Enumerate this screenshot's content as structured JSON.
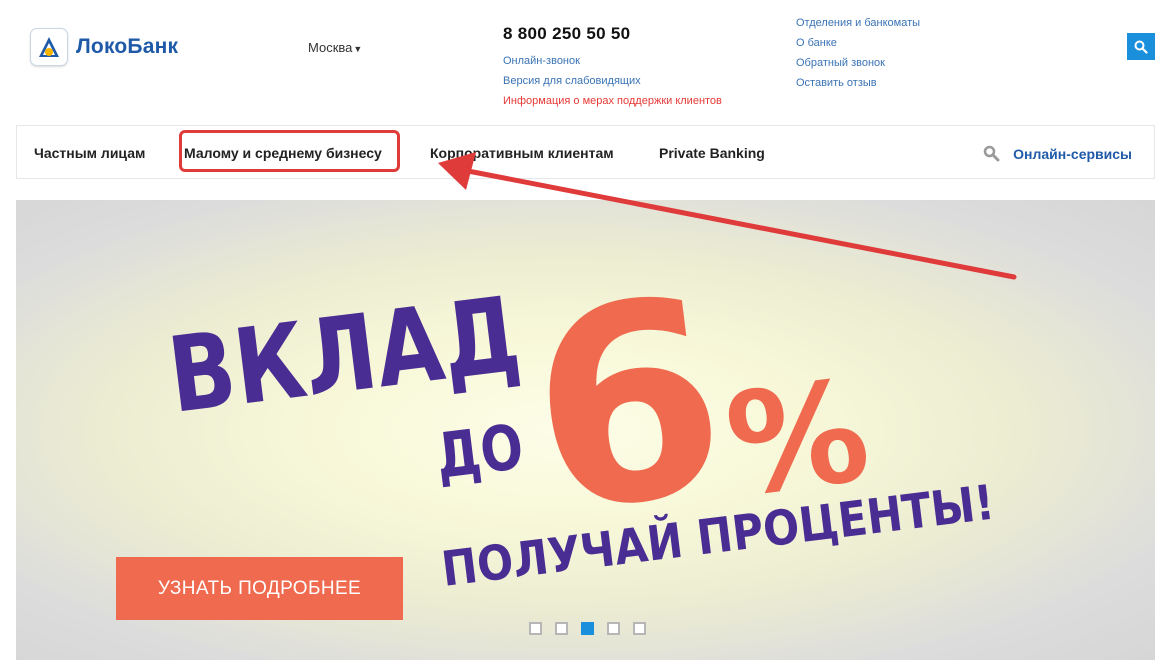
{
  "header": {
    "logo_text": "ЛокоБанк",
    "city": "Москва",
    "phone": "8 800 250 50 50",
    "phone_links": [
      "Онлайн-звонок",
      "Версия для слабовидящих"
    ],
    "support_info": "Информация о мерах поддержки клиентов",
    "right_links": [
      "Отделения и банкоматы",
      "О банке",
      "Обратный звонок",
      "Оставить отзыв"
    ]
  },
  "nav": {
    "items": [
      "Частным лицам",
      "Малому и среднему бизнесу",
      "Корпоративным клиентам",
      "Private Banking"
    ],
    "online_services": "Онлайн-сервисы"
  },
  "banner": {
    "line1": "ВКЛАД",
    "line2": "ДО",
    "big_number": "6",
    "percent": "%",
    "line3": "ПОЛУЧАЙ ПРОЦЕНТЫ!",
    "cta": "УЗНАТЬ ПОДРОБНЕЕ",
    "slides_total": 5,
    "active_slide": 3
  },
  "colors": {
    "brand_blue": "#1f5aa8",
    "accent_blue": "#1a8fdc",
    "banner_purple": "#4a2d93",
    "banner_orange": "#ef6a4e",
    "annotation_red": "#e03b3b"
  }
}
